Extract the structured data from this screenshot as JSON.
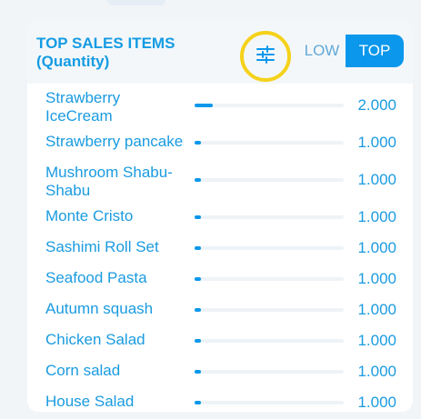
{
  "header": {
    "title": "TOP SALES ITEMS (Quantity)",
    "filter_icon": "sliders-icon",
    "toggle": {
      "low_label": "LOW",
      "top_label": "TOP",
      "selected": "TOP"
    }
  },
  "colors": {
    "accent": "#0a97ec",
    "text": "#1a9be0",
    "highlight_ring": "#f5d21a"
  },
  "items": [
    {
      "name": "Strawberry IceCream",
      "value": "2.000",
      "fill_fraction": 0.12
    },
    {
      "name": "Strawberry pancake",
      "value": "1.000",
      "fill_fraction": 0.04
    },
    {
      "name": "Mushroom Shabu-Shabu",
      "value": "1.000",
      "fill_fraction": 0.04
    },
    {
      "name": "Monte Cristo",
      "value": "1.000",
      "fill_fraction": 0.04
    },
    {
      "name": "Sashimi Roll Set",
      "value": "1.000",
      "fill_fraction": 0.04
    },
    {
      "name": "Seafood Pasta",
      "value": "1.000",
      "fill_fraction": 0.04
    },
    {
      "name": "Autumn squash",
      "value": "1.000",
      "fill_fraction": 0.04
    },
    {
      "name": "Chicken Salad",
      "value": "1.000",
      "fill_fraction": 0.04
    },
    {
      "name": "Corn salad",
      "value": "1.000",
      "fill_fraction": 0.04
    },
    {
      "name": "House Salad",
      "value": "1.000",
      "fill_fraction": 0.04
    }
  ]
}
